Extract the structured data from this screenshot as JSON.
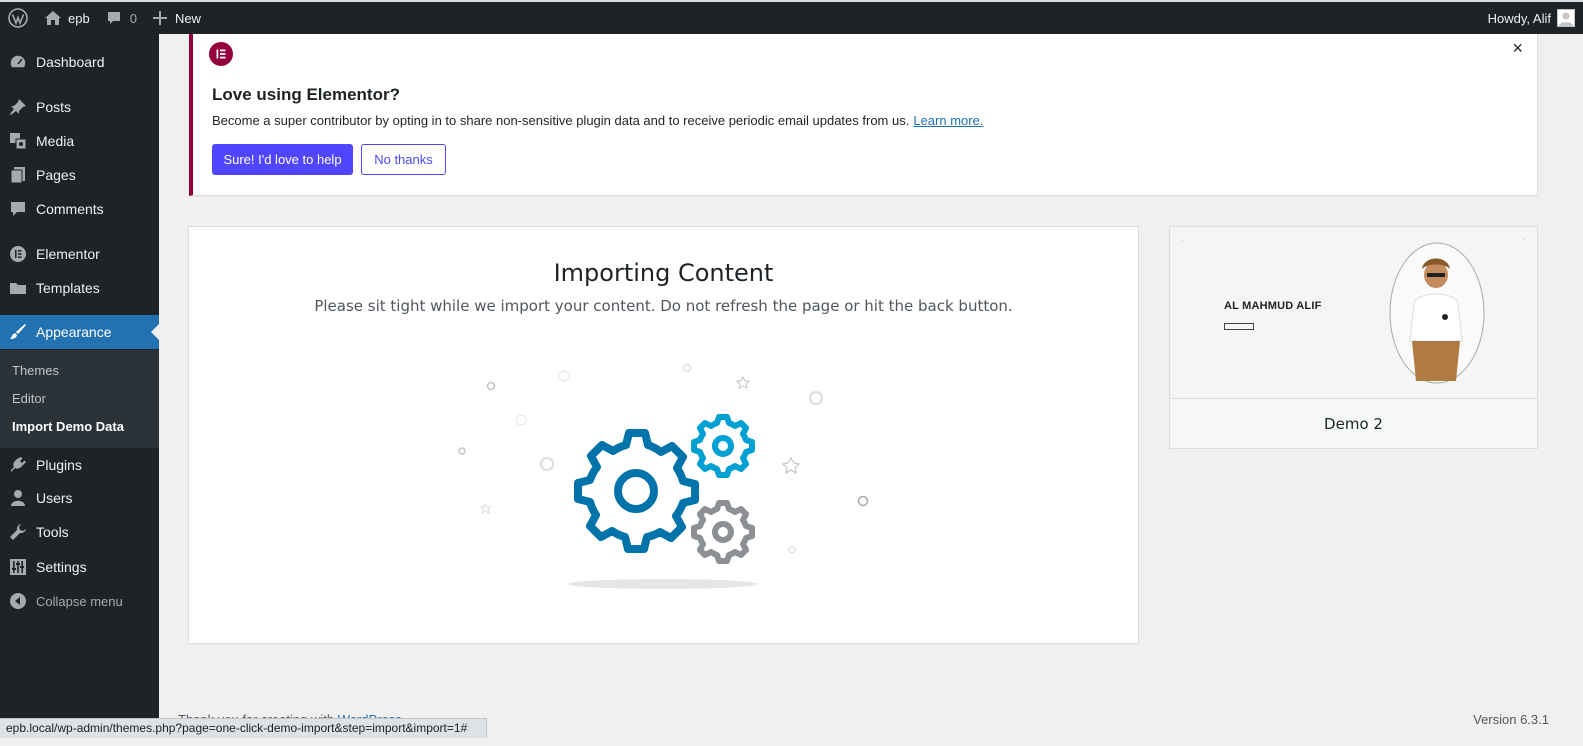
{
  "adminbar": {
    "site_name": "epb",
    "comments_count": "0",
    "new_label": "New",
    "howdy": "Howdy, Alif"
  },
  "sidebar": {
    "items": [
      {
        "label": "Dashboard",
        "icon": "dashboard-icon"
      },
      {
        "label": "Posts",
        "icon": "pin-icon"
      },
      {
        "label": "Media",
        "icon": "media-icon"
      },
      {
        "label": "Pages",
        "icon": "pages-icon"
      },
      {
        "label": "Comments",
        "icon": "comment-icon"
      },
      {
        "label": "Elementor",
        "icon": "elementor-icon"
      },
      {
        "label": "Templates",
        "icon": "folder-icon"
      },
      {
        "label": "Appearance",
        "icon": "brush-icon"
      },
      {
        "label": "Plugins",
        "icon": "plugin-icon"
      },
      {
        "label": "Users",
        "icon": "user-icon"
      },
      {
        "label": "Tools",
        "icon": "wrench-icon"
      },
      {
        "label": "Settings",
        "icon": "sliders-icon"
      }
    ],
    "submenu": [
      "Themes",
      "Editor",
      "Import Demo Data"
    ],
    "collapse_label": "Collapse menu"
  },
  "notice": {
    "title": "Love using Elementor?",
    "text": "Become a super contributor by opting in to share non-sensitive plugin data and to receive periodic email updates from us.",
    "link": "Learn more.",
    "primary_btn": "Sure! I'd love to help",
    "secondary_btn": "No thanks",
    "close": "×"
  },
  "import": {
    "title": "Importing Content",
    "subtitle": "Please sit tight while we import your content. Do not refresh the page or hit the back button."
  },
  "demo": {
    "label": "Demo 2",
    "thumb_name": "AL MAHMUD ALIF"
  },
  "footer": {
    "thanks_prefix": "Thank you for creating with",
    "thanks_link": "WordPress",
    "version": "Version 6.3.1"
  },
  "statusbar": {
    "url": "epb.local/wp-admin/themes.php?page=one-click-demo-import&step=import&import=1#"
  },
  "colors": {
    "accent": "#2271b1",
    "elementor": "#93003c",
    "button": "#5046ff",
    "gear_blue": "#0073aa",
    "gear_cyan": "#00a0d2",
    "gear_gray": "#8c8f94"
  }
}
